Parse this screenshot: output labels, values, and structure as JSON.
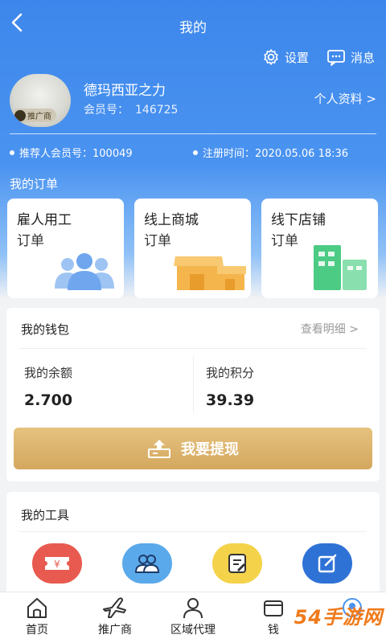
{
  "header": {
    "title": "我的",
    "back_icon": "back-arrow-icon"
  },
  "top_actions": {
    "settings": "设置",
    "messages": "消息"
  },
  "profile": {
    "name": "德玛西亚之力",
    "member_label": "会员号：",
    "member_no": "146725",
    "badge": "推广商",
    "personal_link": "个人资料 >"
  },
  "meta": {
    "referrer": "推荐人会员号：100049",
    "register_time": "注册时间：2020.05.06 18:36"
  },
  "orders": {
    "title": "我的订单",
    "cards": [
      {
        "title": "雇人用工",
        "sub": "订单",
        "icon": "people-group-icon"
      },
      {
        "title": "线上商城",
        "sub": "订单",
        "icon": "shop-icon"
      },
      {
        "title": "线下店铺",
        "sub": "订单",
        "icon": "building-icon"
      }
    ]
  },
  "wallet": {
    "title": "我的钱包",
    "detail_link": "查看明细 >",
    "balance_label": "我的余额",
    "balance_value": "2.700",
    "points_label": "我的积分",
    "points_value": "39.39",
    "withdraw_label": "我要提现"
  },
  "tools": {
    "title": "我的工具",
    "items": [
      {
        "icon": "ticket-icon",
        "color": "#e85a4f"
      },
      {
        "icon": "team-icon",
        "color": "#5aa9ea"
      },
      {
        "icon": "notepad-icon",
        "color": "#f4d24a"
      },
      {
        "icon": "edit-icon",
        "color": "#2e72d6"
      }
    ]
  },
  "tabbar": {
    "items": [
      {
        "label": "首页",
        "icon": "home-icon"
      },
      {
        "label": "推广商",
        "icon": "plane-icon"
      },
      {
        "label": "区域代理",
        "icon": "person-icon"
      },
      {
        "label": "钱",
        "icon": "wallet-icon"
      },
      {
        "label": "",
        "icon": "profile-icon"
      }
    ]
  },
  "watermark": "54手游网",
  "colors": {
    "primary": "#3d87ec",
    "gold": "#d4a75e"
  }
}
